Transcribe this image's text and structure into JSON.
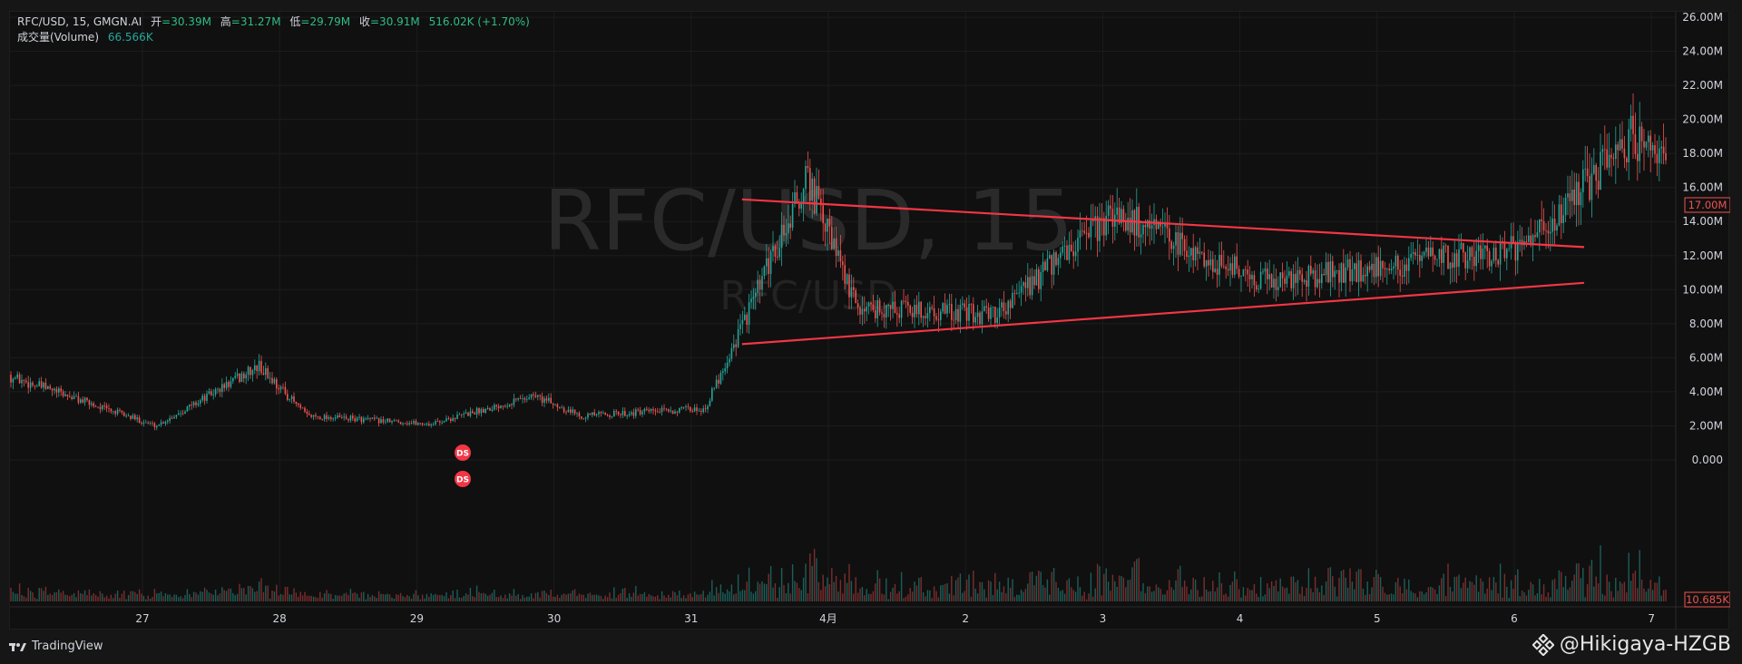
{
  "legend": {
    "symbol": "RFC/USD, 15, GMGN.AI",
    "open_label": "开",
    "open_value": "=30.39M",
    "high_label": "高",
    "high_value": "=31.27M",
    "low_label": "低",
    "low_value": "=29.79M",
    "close_label": "收",
    "close_value": "=30.91M",
    "change": "516.02K (+1.70%)",
    "volume_label": "成交量(Volume)",
    "volume_value": "66.566K"
  },
  "watermark": {
    "big": "RFC/USD, 15",
    "small": "RFC/USD"
  },
  "price_scale": {
    "labels": [
      "26.00M",
      "24.00M",
      "22.00M",
      "20.00M",
      "18.00M",
      "16.00M",
      "14.00M",
      "12.00M",
      "10.00M",
      "8.00M",
      "6.00M",
      "4.00M",
      "2.00M",
      "0.000"
    ],
    "current_price": "17.00M",
    "volume_current": "10.685K"
  },
  "time_scale": {
    "labels": [
      "27",
      "28",
      "29",
      "30",
      "31",
      "4月",
      "2",
      "3",
      "4",
      "5",
      "6",
      "7"
    ]
  },
  "markers": [
    "DS",
    "DS"
  ],
  "branding": {
    "platform": "TradingView",
    "author": "@Hikigaya-HZGB"
  },
  "colors": {
    "up": "#26a69a",
    "down": "#ef5350",
    "trendline": "#f23645",
    "background": "#101010",
    "text": "#d1d4dc"
  },
  "chart_data": {
    "type": "candlestick",
    "symbol": "RFC/USD",
    "interval": "15",
    "x_range": [
      "26",
      "7"
    ],
    "ylim": [
      0,
      26000000
    ],
    "grid": true,
    "series": [
      {
        "values": [
          {
            "date": "26",
            "price": 5000000
          },
          {
            "date": "27",
            "price": 2000000
          },
          {
            "date": "27",
            "price": 5500000
          },
          {
            "date": "28",
            "price": 2600000
          },
          {
            "date": "29",
            "price": 2100000
          },
          {
            "date": "29",
            "price": 3800000
          },
          {
            "date": "30",
            "price": 2600000
          },
          {
            "date": "31",
            "price": 3000000
          },
          {
            "date": "31",
            "price": 16500000
          },
          {
            "date": "4月",
            "price": 9000000
          },
          {
            "date": "2",
            "price": 8500000
          },
          {
            "date": "3",
            "price": 14500000
          },
          {
            "date": "3",
            "price": 11500000
          },
          {
            "date": "4",
            "price": 10500000
          },
          {
            "date": "5",
            "price": 11500000
          },
          {
            "date": "6",
            "price": 12500000
          },
          {
            "date": "6",
            "price": 19000000
          },
          {
            "date": "7",
            "price": 17000000
          }
        ]
      }
    ],
    "trendlines": [
      {
        "role": "upper",
        "points": [
          {
            "date": "31",
            "price": 15300000
          },
          {
            "date": "6",
            "price": 12500000
          }
        ]
      },
      {
        "role": "lower",
        "points": [
          {
            "date": "31",
            "price": 6800000
          },
          {
            "date": "6",
            "price": 10400000
          }
        ]
      }
    ]
  }
}
